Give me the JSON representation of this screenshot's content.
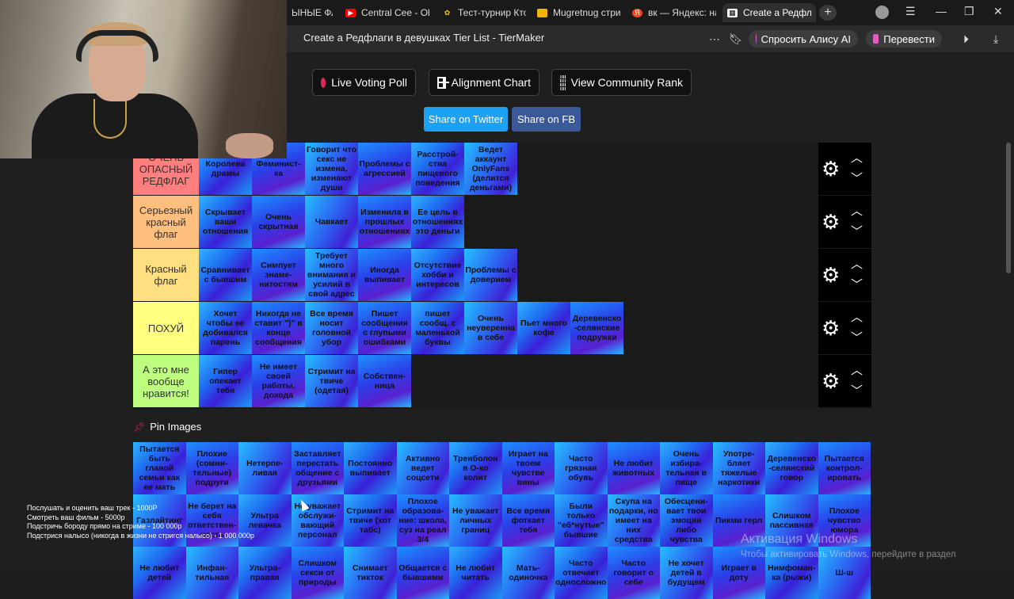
{
  "browser": {
    "tabs": [
      {
        "label": "ЫНЫЕ ФЛАГ",
        "favicon": "none",
        "color": "#888888"
      },
      {
        "label": "Central Cee - Obs",
        "favicon": "youtube-icon",
        "color": "#ff0000"
      },
      {
        "label": "Тест-турнир Кто",
        "favicon": "trophy-icon",
        "color": "#f4c20d"
      },
      {
        "label": "Mugretnug стри",
        "favicon": "bookmark-icon",
        "color": "#f4b400"
      },
      {
        "label": "вк — Яндекс: нас",
        "favicon": "yandex-icon",
        "color": "#fc3f1d"
      },
      {
        "label": "Create a Редфл",
        "favicon": "tiermaker-icon",
        "color": "#ffffff",
        "active": true
      }
    ],
    "page_title": "Create a Редфлаги в девушках Tier List - TierMaker",
    "ask_alice": "Спросить Алису AI",
    "translate": "Перевести"
  },
  "toolbar": {
    "live_voting": "Live Voting Poll",
    "alignment_chart": "Alignment Chart",
    "community_rank": "View Community Rank",
    "share_twitter": "Share on Twitter",
    "share_fb": "Share on FB"
  },
  "tiers": [
    {
      "label": "ОЧЕНЬ ОПАСНЫЙ РЕДФЛАГ",
      "color": "#ff7f7f",
      "items": [
        "Королева драмы",
        "Феминист-ка",
        "Говорит что секс не измена, изменяют души",
        "Проблемы с агрессией",
        "Расстрой-ства пищевого поведения",
        "Ведет аккаунт OnlyFans (делится деньгами)"
      ]
    },
    {
      "label": "Серьезный красный флаг",
      "color": "#ffbf7f",
      "items": [
        "Скрывает ваши отношения",
        "Очень скрытная",
        "Чавкает",
        "Изменила в прошлых отношениях",
        "Ее цель в отношениях это деньги"
      ]
    },
    {
      "label": "Красный флаг",
      "color": "#ffdf7f",
      "items": [
        "Сравнивает с бывшим",
        "Симпует знаме-нитостям",
        "Требует много внимания и усилий в свой адрес",
        "Иногда выпивает",
        "Отсутствие хобби и интересов",
        "Проблемы с доверием"
      ]
    },
    {
      "label": "ПОХУЙ",
      "color": "#ffff7f",
      "items": [
        "Хочет чтобы ее добивался парень",
        "Никогда не ставит \")\" в конце сообщения",
        "Все время носит головной убор",
        "Пишет сообщения с глупыми ошибками",
        "пишет сообщ. с маленькой буквы",
        "Очень неуверенна в себе",
        "Пьет много кофе",
        "Деревенско-селянские подружки"
      ]
    },
    {
      "label": "А это мне вообще нравится!",
      "color": "#bfff7f",
      "items": [
        "Гипер опекает тебя",
        "Не имеет своей работы, дохода",
        "Стримит на твиче (одетая)",
        "Собствен-ница"
      ]
    }
  ],
  "pin_images": "Pin Images",
  "pool": [
    "Пытается быть главой семьи как ее мать",
    "Плохие (сомни-тельные) подруги",
    "Нетерпе-ливая",
    "Заставляет перестать общение с друзьями",
    "Постоянно выпивает",
    "Активно ведет соцсети",
    "Тренболон в О-ко колит",
    "Играет на твоем чувстве вины",
    "Часто грязная обувь",
    "Не любит животных",
    "Очень избира-тельная в пище",
    "Употре-бляет тяжелые наркотики",
    "Деревенско-селянский говор",
    "Пытается контрол-ировать",
    "Газлайтинг",
    "Не берет на себя ответствен-ность",
    "Ультра левачка",
    "Не уважает обслужи-вающий персонал",
    "Стримит на твиче (хот табс)",
    "Плохое образова-ние: школа, суз на реал 3/4",
    "Не уважает личных границ",
    "Все время фоткает тебя",
    "Были только \"еб*нутые\" бывшие",
    "Скупа на подарки, но имеет на них средства",
    "Обесцени-вает твои эмоции либо чувства",
    "Пикми герл",
    "Слишком пассивная",
    "Плохое чувство юмора",
    "Не любит детей",
    "Инфан-тильная",
    "Ультра-правая",
    "Слишком секси от природы",
    "Снимает тикток",
    "Общается с бывшими",
    "Не любит читать",
    "Мать-одиночка",
    "Часто отвечает односложно",
    "Часто говорит о себе",
    "Не хочет детей в будущем",
    "Играет в доту",
    "Нимфоман-ка (рыжи)",
    "Ш-ш"
  ],
  "stream_overlay": [
    "Послушать и оценить ваш трек - 1000Р",
    "Смотреть ваш фильм - 5000р",
    "Подстричь бороду прямо на стриме - 100 000р",
    "Подстрися налысо (никогда в жизни не стригся налысо) - 1 000 000р"
  ],
  "watermark": {
    "title": "Активация Windows",
    "subtitle": "Чтобы активировать Windows, перейдите в раздел"
  }
}
